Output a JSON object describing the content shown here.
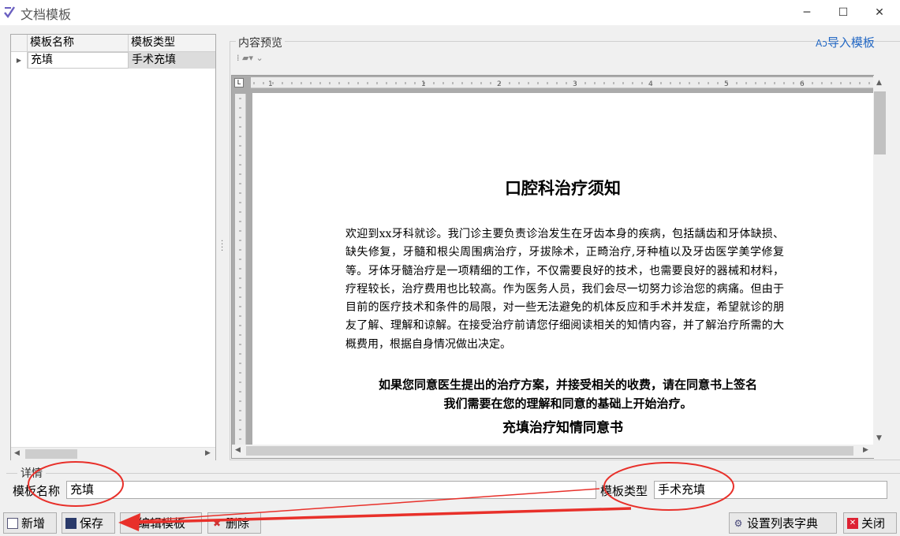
{
  "window": {
    "title": "文档模板",
    "minimize_glyph": "─",
    "maximize_glyph": "☐",
    "close_glyph": "✕"
  },
  "grid": {
    "columns": [
      "模板名称",
      "模板类型"
    ],
    "rows": [
      {
        "name": "充填",
        "type": "手术充填"
      }
    ]
  },
  "preview": {
    "label": "内容预览",
    "import_label": "导入模板",
    "ruler_marks": [
      "1",
      "1",
      "2",
      "3",
      "4",
      "5",
      "6"
    ],
    "document": {
      "title": "口腔科治疗须知",
      "body": "欢迎到xx牙科就诊。我门诊主要负责诊治发生在牙齿本身的疾病，包括龋齿和牙体缺损、缺失修复，牙髓和根尖周围病治疗，牙拔除术，正畸治疗,牙种植以及牙齿医学美学修复等。牙体牙髓治疗是一项精细的工作，不仅需要良好的技术，也需要良好的器械和材料，疗程较长，治疗费用也比较高。作为医务人员，我们会尽一切努力诊治您的病痛。但由于目前的医疗技术和条件的局限，对一些无法避免的机体反应和手术并发症，希望就诊的朋友了解、理解和谅解。在接受治疗前请您仔细阅读相关的知情内容，并了解治疗所需的大概费用，根据自身情况做出决定。",
      "bold_line1": "如果您同意医生提出的治疗方案，并接受相关的收费，请在同意书上签名",
      "bold_line2": "我们需要在您的理解和同意的基础上开始治疗。",
      "subtitle": "充填治疗知情同意书"
    }
  },
  "details": {
    "label": "详情",
    "name_label": "模板名称",
    "name_value": "充填",
    "type_label": "模板类型",
    "type_value": "手术充填"
  },
  "buttons": {
    "new": "新增",
    "save": "保存",
    "edit": "编辑模板",
    "delete": "删除",
    "set_columns": "设置列表字典",
    "close": "关闭"
  },
  "colors": {
    "annotation": "#e8302a",
    "link": "#2368c4"
  }
}
